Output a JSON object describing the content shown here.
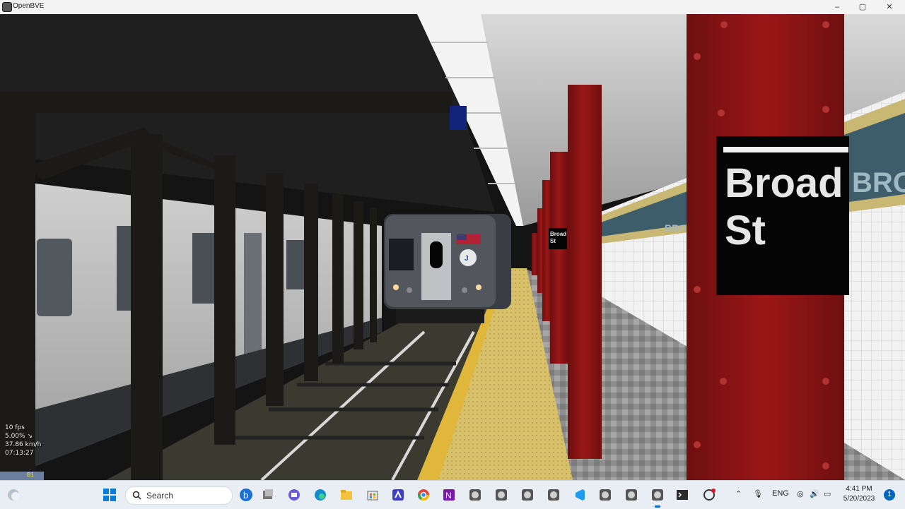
{
  "window": {
    "title": "OpenBVE",
    "controls": {
      "minimize": "–",
      "maximize": "▢",
      "close": "✕"
    }
  },
  "scene": {
    "station_sign_large": {
      "line1": "Broad",
      "line2": "St"
    },
    "station_sign_small": {
      "line1": "Broad",
      "line2": "St"
    },
    "wall_mosaic_text": "BRO",
    "wall_mosaic_text_far": "BRO",
    "train_route_bullet": "J"
  },
  "hud": {
    "fps": "10 fps",
    "gradient": "5.00% ↘",
    "speed": "37.86 km/h",
    "time": "07:13:27",
    "notch": "B1"
  },
  "taskbar": {
    "search_label": "Search",
    "language": "ENG",
    "clock_time": "4:41 PM",
    "clock_date": "5/20/2023",
    "notification_count": "1",
    "icons": [
      "weather-icon",
      "start-icon",
      "search-icon",
      "bing-icon",
      "task-view-icon",
      "teams-chat-icon",
      "edge-icon",
      "file-explorer-icon",
      "store-icon",
      "visual-studio-icon",
      "chrome-icon",
      "onenote-icon",
      "openbve-icon",
      "openbve-icon",
      "openbve-icon",
      "openbve-icon",
      "vscode-icon",
      "openbve-icon",
      "openbve-icon",
      "openbve-icon",
      "terminal-icon",
      "openai-icon"
    ]
  },
  "colors": {
    "column_red": "#8c1414",
    "platform_yellow": "#d8c06a",
    "taskbar_bg": "#e9eef5",
    "accent": "#0067c0"
  }
}
